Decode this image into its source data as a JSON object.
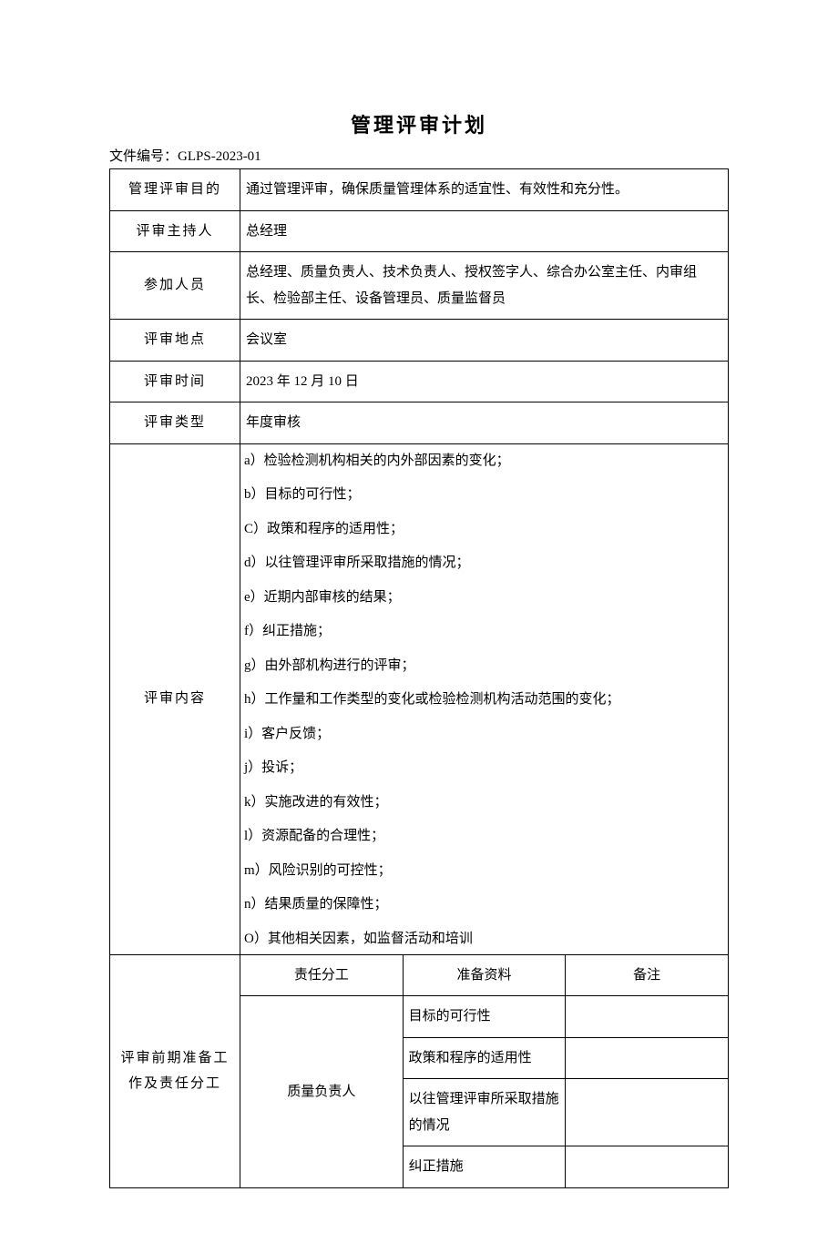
{
  "title": "管理评审计划",
  "doc_number_label": "文件编号：",
  "doc_number": "GLPS-2023-01",
  "rows": {
    "purpose_label": "管理评审目的",
    "purpose_value": "通过管理评审，确保质量管理体系的适宜性、有效性和充分性。",
    "host_label": "评审主持人",
    "host_value": "总经理",
    "attendees_label": "参加人员",
    "attendees_value": "总经理、质量负责人、技术负责人、授权签字人、综合办公室主任、内审组长、检验部主任、设备管理员、质量监督员",
    "location_label": "评审地点",
    "location_value": "会议室",
    "time_label": "评审时间",
    "time_value": "2023 年 12 月 10 日",
    "type_label": "评审类型",
    "type_value": "年度审核",
    "content_label": "评审内容",
    "content_items": [
      "a）检验检测机构相关的内外部因素的变化；",
      "b）目标的可行性；",
      "C）政策和程序的适用性；",
      "d）以往管理评审所采取措施的情况；",
      "e）近期内部审核的结果；",
      "f）纠正措施；",
      "g）由外部机构进行的评审；",
      "h）工作量和工作类型的变化或检验检测机构活动范围的变化；",
      "i）客户反馈；",
      "j）投诉；",
      "k）实施改进的有效性；",
      "l）资源配备的合理性；",
      "m）风险识别的可控性；",
      "n）结果质量的保障性；",
      "O）其他相关因素，如监督活动和培训"
    ],
    "prep_label": "评审前期准备工作及责任分工",
    "sub_headers": {
      "duty": "责任分工",
      "material": "准备资料",
      "remark": "备注"
    },
    "prep_person": "质量负责人",
    "prep_materials": [
      "目标的可行性",
      "政策和程序的适用性",
      "以往管理评审所采取措施的情况",
      "纠正措施"
    ]
  }
}
